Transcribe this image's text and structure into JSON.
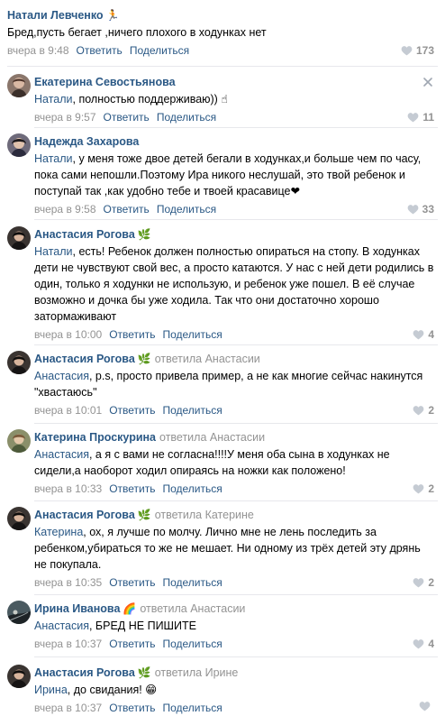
{
  "comments": [
    {
      "author": "Натали Левченко",
      "badge": "🏃",
      "reply_to": "",
      "mention": "",
      "text": "Бред,пусть бегает ,ничего плохого в ходунках нет",
      "date": "вчера в 9:48",
      "reply_label": "Ответить",
      "share_label": "Поделиться",
      "likes": "173",
      "avatar": ""
    },
    {
      "author": "Екатерина Севостьянова",
      "badge": "",
      "reply_to": "",
      "mention": "Натали",
      "text": ", полностью поддерживаю)) ☝",
      "date": "вчера в 9:57",
      "reply_label": "Ответить",
      "share_label": "Поделиться",
      "likes": "11",
      "avatar": "#6b5a52"
    },
    {
      "author": "Надежда Захарова",
      "badge": "",
      "reply_to": "",
      "mention": "Натали",
      "text": ", у меня тоже двое детей бегали в ходунках,и больше чем по часу, пока сами непошли.Поэтому Ира никого неслушай, это твой ребенок и поступай так ,как удобно тебе и твоей красавице❤",
      "date": "вчера в 9:58",
      "reply_label": "Ответить",
      "share_label": "Поделиться",
      "likes": "33",
      "avatar": "#4f4a5e"
    },
    {
      "author": "Анастасия Рогова",
      "badge": "🌿",
      "reply_to": "",
      "mention": "Натали",
      "text": ", есть! Ребенок должен полностью опираться на стопу. В ходунках дети не чувствуют свой вес, а просто катаются. У нас с ней дети родились в один, только я ходунки не использую, и ребенок уже пошел. В её случае возможно и дочка бы уже ходила. Так что они достаточно хорошо затормаживают",
      "date": "вчера в 10:00",
      "reply_label": "Ответить",
      "share_label": "Поделиться",
      "likes": "4",
      "avatar": "#2e2a28"
    },
    {
      "author": "Анастасия Рогова",
      "badge": "🌿",
      "reply_to": "ответила Анастасии",
      "mention": "Анастасия",
      "text": ", p.s, просто привела пример, а не как многие сейчас накинутся \"хвастаюсь\"",
      "date": "вчера в 10:01",
      "reply_label": "Ответить",
      "share_label": "Поделиться",
      "likes": "2",
      "avatar": "#2e2a28"
    },
    {
      "author": "Катерина Проскурина",
      "badge": "",
      "reply_to": "ответила Анастасии",
      "mention": "Анастасия",
      "text": ", а я с вами не согласна!!!!У меня оба сына в ходунках не сидели,а наоборот ходил опираясь на ножки как положено!",
      "date": "вчера в 10:33",
      "reply_label": "Ответить",
      "share_label": "Поделиться",
      "likes": "2",
      "avatar": "#6b6f4e"
    },
    {
      "author": "Анастасия Рогова",
      "badge": "🌿",
      "reply_to": "ответила Катерине",
      "mention": "Катерина",
      "text": ", ох, я лучше по молчу. Лично мне не лень последить за ребенком,убираться то же не мешает. Ни одному из трёх детей эту дрянь не покупала.",
      "date": "вчера в 10:35",
      "reply_label": "Ответить",
      "share_label": "Поделиться",
      "likes": "2",
      "avatar": "#2e2a28"
    },
    {
      "author": "Ирина Иванова",
      "badge": "🌈",
      "reply_to": "ответила Анастасии",
      "mention": "Анастасия",
      "text": ", БРЕД НЕ ПИШИТЕ",
      "date": "вчера в 10:37",
      "reply_label": "Ответить",
      "share_label": "Поделиться",
      "likes": "4",
      "avatar": "#3a4a50"
    },
    {
      "author": "Анастасия Рогова",
      "badge": "🌿",
      "reply_to": "ответила Ирине",
      "mention": "Ирина",
      "text": ", до свидания! 😁",
      "date": "вчера в 10:37",
      "reply_label": "Ответить",
      "share_label": "Поделиться",
      "likes": "",
      "avatar": "#2e2a28"
    }
  ],
  "colors": {
    "link": "#2a5885",
    "muted": "#939393",
    "divider": "#e7e8ec"
  }
}
